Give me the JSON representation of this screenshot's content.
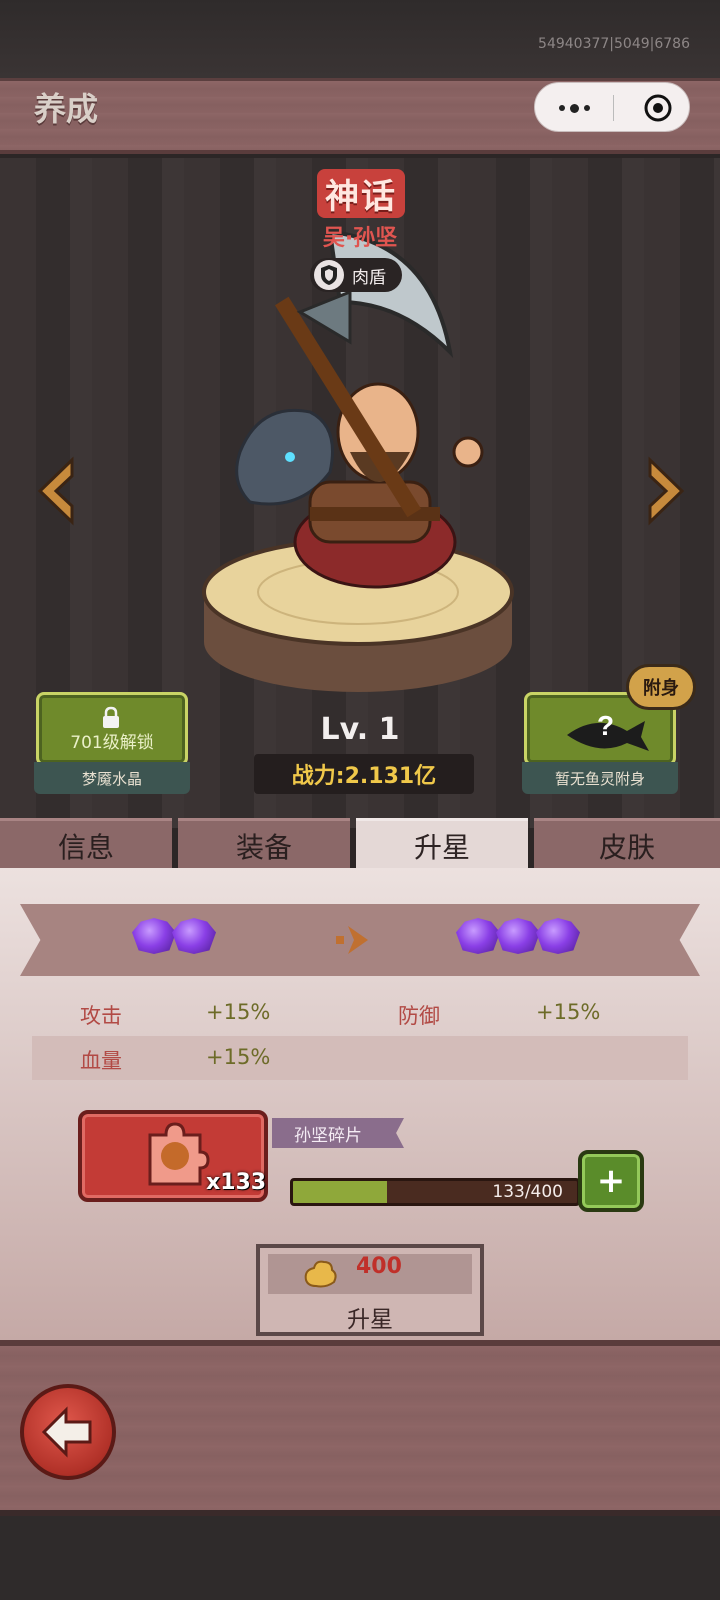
{
  "debug_id": "54940377|5049|6786",
  "header": {
    "title": "养成"
  },
  "hero": {
    "rarity": "神话",
    "name": "吴·孙坚",
    "role": "肉盾",
    "level": "Lv. 1",
    "power": "战力:2.131亿"
  },
  "left_panel": {
    "lock_text": "701级解锁",
    "caption": "梦魇水晶"
  },
  "right_panel": {
    "badge": "附身",
    "caption": "暂无鱼灵附身",
    "question": "?"
  },
  "tabs": [
    {
      "label": "信息",
      "active": false
    },
    {
      "label": "装备",
      "active": false
    },
    {
      "label": "升星",
      "active": true
    },
    {
      "label": "皮肤",
      "active": false
    }
  ],
  "star_upgrade": {
    "stats": [
      {
        "label": "攻击",
        "value": "+15%"
      },
      {
        "label": "防御",
        "value": "+15%"
      },
      {
        "label": "血量",
        "value": "+15%"
      }
    ],
    "shard_name": "孙坚碎片",
    "shard_count": "x133",
    "progress_text": "133/400",
    "progress": 0.3325,
    "add_label": "+",
    "cost": "400",
    "upgrade_label": "升星"
  },
  "colors": {
    "rarity_red": "#c8413c",
    "accent_green": "#6f8a2b",
    "cost_red": "#c0302a"
  }
}
